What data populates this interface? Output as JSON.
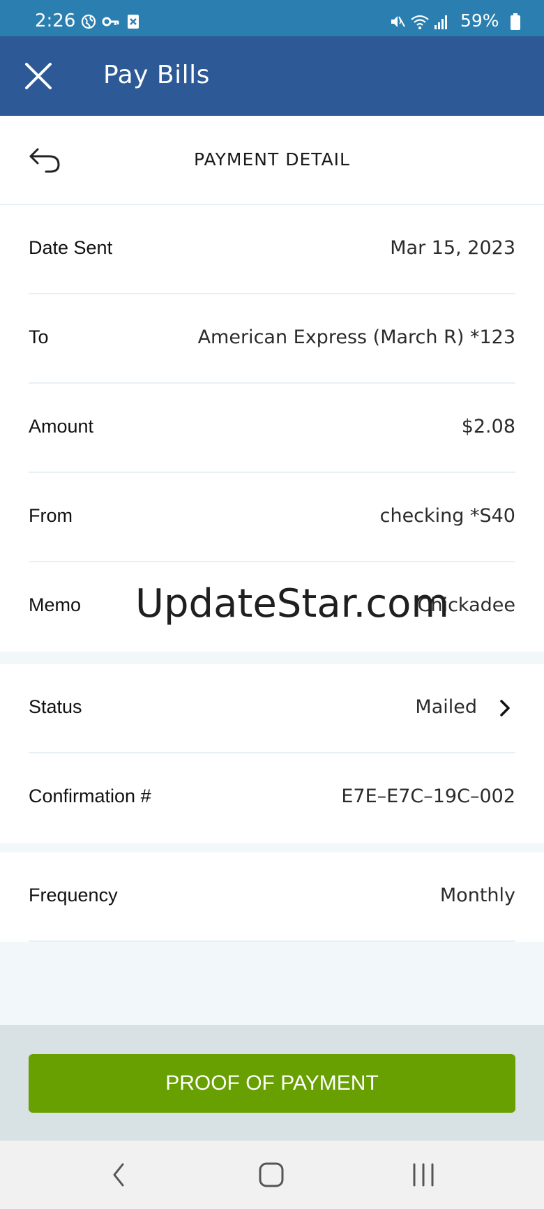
{
  "status_bar": {
    "time": "2:26",
    "battery": "59%",
    "icons": [
      "globe-icon",
      "key-icon",
      "document-icon",
      "mute-icon",
      "wifi-icon",
      "signal-icon",
      "battery-icon"
    ]
  },
  "app_bar": {
    "title": "Pay Bills",
    "close_icon": "close-icon"
  },
  "section": {
    "title": "PAYMENT DETAIL",
    "back_icon": "back-icon"
  },
  "details": [
    {
      "label": "Date Sent",
      "value": "Mar 15, 2023"
    },
    {
      "label": "To",
      "value": "American Express (March R) *123"
    },
    {
      "label": "Amount",
      "value": "$2.08"
    },
    {
      "label": "From",
      "value": "checking *S40"
    },
    {
      "label": "Memo",
      "value": "Chickadee"
    }
  ],
  "status_group": [
    {
      "label": "Status",
      "value": "Mailed",
      "icon": "chevron-right-icon"
    },
    {
      "label": "Confirmation #",
      "value": "E7E–E7C–19C–002"
    }
  ],
  "frequency_group": [
    {
      "label": "Frequency",
      "value": "Monthly"
    }
  ],
  "watermark": "UpdateStar.com",
  "proof_button": "PROOF OF PAYMENT",
  "nav_bar": [
    "back-nav-icon",
    "home-nav-icon",
    "recents-nav-icon"
  ],
  "colors": {
    "status_bar": "#2a7fb0",
    "app_bar": "#2d5a97",
    "accent_button": "#67a000",
    "divider": "#e8f0f3",
    "background_light": "#f2f8fa"
  }
}
